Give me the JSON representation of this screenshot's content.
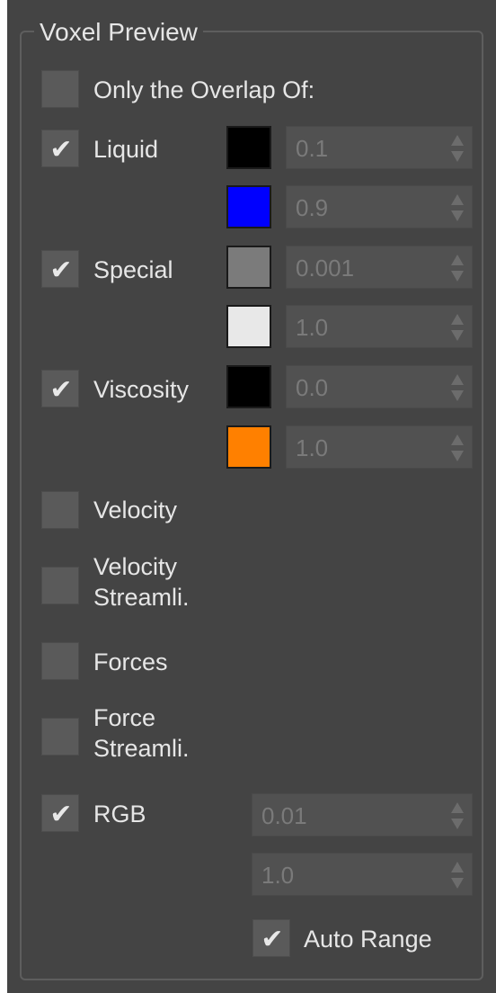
{
  "panel": {
    "title": "Voxel Preview"
  },
  "overlap": {
    "label": "Only the Overlap Of:",
    "checked": false
  },
  "liquid": {
    "label": "Liquid",
    "checked": true,
    "color_low": "#000000",
    "value_low": "0.1",
    "color_high": "#0000ff",
    "value_high": "0.9"
  },
  "special": {
    "label": "Special",
    "checked": true,
    "color_low": "#7b7b7b",
    "value_low": "0.001",
    "color_high": "#e8e8e8",
    "value_high": "1.0"
  },
  "viscosity": {
    "label": "Viscosity",
    "checked": true,
    "color_low": "#000000",
    "value_low": "0.0",
    "color_high": "#ff8000",
    "value_high": "1.0"
  },
  "velocity": {
    "label": "Velocity",
    "checked": false
  },
  "velocity_streamlines": {
    "label_line1": "Velocity",
    "label_line2": "Streamli.",
    "checked": false
  },
  "forces": {
    "label": "Forces",
    "checked": false
  },
  "force_streamlines": {
    "label_line1": "Force",
    "label_line2": "Streamli.",
    "checked": false
  },
  "rgb": {
    "label": "RGB",
    "checked": true,
    "value_low": "0.01",
    "value_high": "1.0"
  },
  "auto_range": {
    "label": "Auto Range",
    "checked": true
  },
  "check_glyph": "✔"
}
